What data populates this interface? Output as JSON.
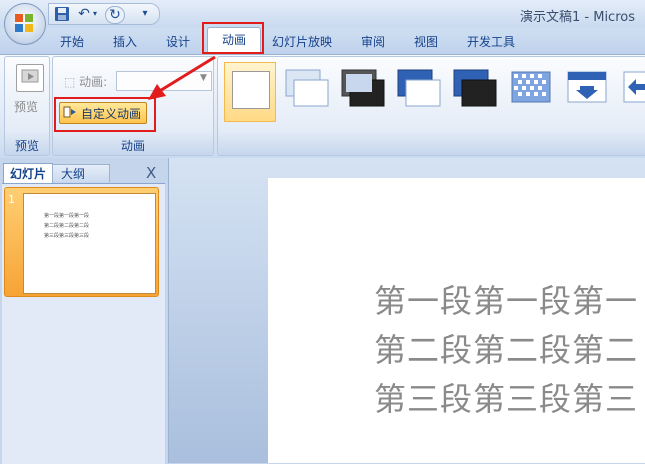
{
  "window": {
    "title": "演示文稿1 - Micros"
  },
  "quick_access": {
    "icons": [
      "save-icon",
      "undo-icon",
      "dropdown-icon",
      "redo-icon",
      "customize-icon"
    ]
  },
  "tabs": [
    "开始",
    "插入",
    "设计",
    "动画",
    "幻灯片放映",
    "审阅",
    "视图",
    "开发工具"
  ],
  "active_tab": "动画",
  "ribbon": {
    "preview_group": {
      "button_label": "预览",
      "group_label": "预览"
    },
    "animation_group": {
      "animation_label": "动画:",
      "animation_value": "",
      "custom_button_label": "自定义动画",
      "group_label": "动画"
    },
    "transitions": [
      "none",
      "fade",
      "fade-through-black",
      "push-down",
      "push-down-dark",
      "dissolve",
      "arrow-down",
      "arrow-left"
    ]
  },
  "pane": {
    "tab_slides": "幻灯片",
    "tab_outline": "大纲",
    "close": "X"
  },
  "slide_list": [
    {
      "number": "1",
      "lines": [
        "第一段第一段第一段",
        "第二段第二段第二段",
        "第三段第三段第三段"
      ]
    }
  ],
  "slide": {
    "lines": [
      "第一段第一段第一",
      "第二段第二段第二",
      "第三段第三段第三"
    ]
  },
  "colors": {
    "highlight_box": "#e21b1b",
    "ribbon_blue": "#15428b"
  }
}
